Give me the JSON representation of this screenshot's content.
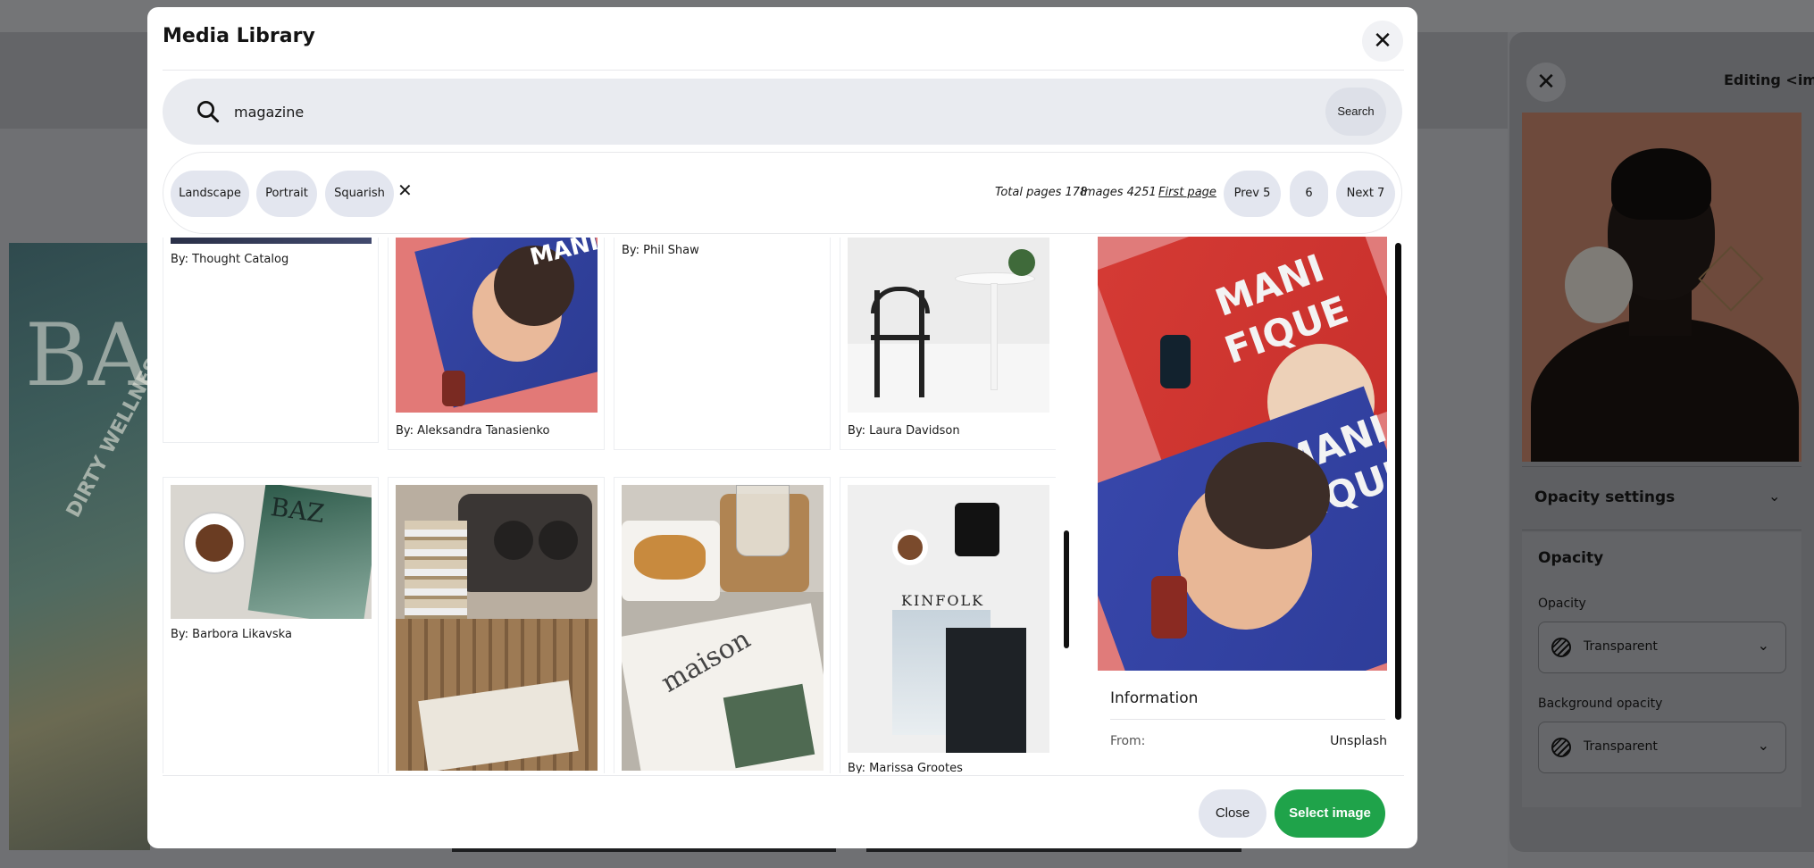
{
  "modal": {
    "title": "Media Library",
    "close_icon": "close-icon"
  },
  "search": {
    "value": "magazine",
    "placeholder": "",
    "button_label": "Search",
    "icon": "search-icon"
  },
  "filters": {
    "chips": [
      "Landscape",
      "Portrait",
      "Squarish"
    ],
    "clear_icon": "clear-filters-icon"
  },
  "pagination": {
    "total_pages": "Total pages 178",
    "images": "Images 4251",
    "first_page": "First page",
    "prev": "Prev 5",
    "current": "6",
    "next": "Next 7"
  },
  "grid": {
    "row1": [
      {
        "byline": "By: Thought Catalog"
      },
      {
        "byline": "By: Aleksandra Tanasienko"
      },
      {
        "byline": "By: Phil Shaw"
      },
      {
        "byline": "By: Laura Davidson"
      }
    ],
    "row2": [
      {
        "byline": "By: Barbora Likavska"
      },
      {
        "byline": ""
      },
      {
        "byline": ""
      },
      {
        "byline": "By: Marissa Grootes"
      }
    ]
  },
  "preview": {
    "info_title": "Information",
    "from_label": "From:",
    "from_value": "Unsplash"
  },
  "footer": {
    "close_label": "Close",
    "select_label": "Select image"
  },
  "editor": {
    "title": "Editing <img>",
    "close_icon": "close-icon",
    "accordion_label": "Opacity settings",
    "section_heading": "Opacity",
    "opacity_label": "Opacity",
    "opacity_value": "Transparent",
    "bg_opacity_label": "Background opacity",
    "bg_opacity_value": "Transparent"
  },
  "background": {
    "magazine_letters": "BA",
    "magazine_cover_text": "DIRTY WELLNESS"
  },
  "colors": {
    "accent_green": "#1fa34a",
    "chip_bg": "#e3e6ef",
    "search_bg": "#e9ebf0"
  }
}
